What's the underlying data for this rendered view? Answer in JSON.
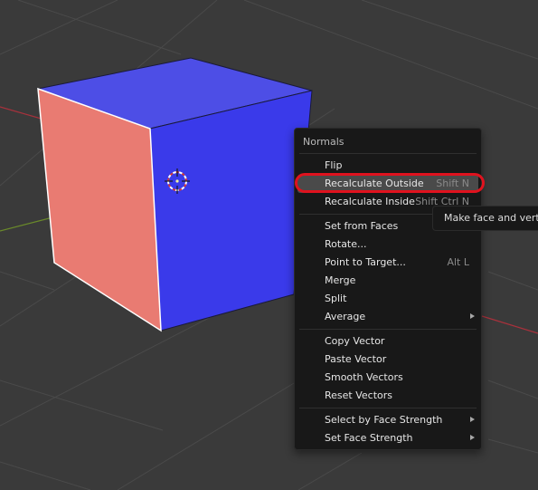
{
  "menu": {
    "title": "Normals",
    "items": [
      {
        "label": "Flip",
        "shortcut": "",
        "submenu": false,
        "highlighted": false
      },
      {
        "label": "Recalculate Outside",
        "shortcut": "Shift N",
        "submenu": false,
        "highlighted": true
      },
      {
        "label": "Recalculate Inside",
        "shortcut": "Shift Ctrl N",
        "submenu": false,
        "highlighted": false
      },
      {
        "label": "Set from Faces",
        "shortcut": "",
        "submenu": false,
        "highlighted": false
      },
      {
        "label": "Rotate...",
        "shortcut": "",
        "submenu": false,
        "highlighted": false
      },
      {
        "label": "Point to Target...",
        "shortcut": "Alt L",
        "submenu": false,
        "highlighted": false
      },
      {
        "label": "Merge",
        "shortcut": "",
        "submenu": false,
        "highlighted": false
      },
      {
        "label": "Split",
        "shortcut": "",
        "submenu": false,
        "highlighted": false
      },
      {
        "label": "Average",
        "shortcut": "",
        "submenu": true,
        "highlighted": false
      },
      {
        "label": "Copy Vector",
        "shortcut": "",
        "submenu": false,
        "highlighted": false
      },
      {
        "label": "Paste Vector",
        "shortcut": "",
        "submenu": false,
        "highlighted": false
      },
      {
        "label": "Smooth Vectors",
        "shortcut": "",
        "submenu": false,
        "highlighted": false
      },
      {
        "label": "Reset Vectors",
        "shortcut": "",
        "submenu": false,
        "highlighted": false
      },
      {
        "label": "Select by Face Strength",
        "shortcut": "",
        "submenu": true,
        "highlighted": false
      },
      {
        "label": "Set Face Strength",
        "shortcut": "",
        "submenu": true,
        "highlighted": false
      }
    ]
  },
  "tooltip": {
    "text": "Make face and verte"
  },
  "colors": {
    "viewport_bg": "#3a3a3a",
    "cube_top": "#4d4ee6",
    "cube_front": "#3a3aea",
    "cube_selected_face": "#e97b72",
    "x_axis": "#a8313c",
    "y_axis": "#6a8a2a",
    "highlight_ring": "#e0121e"
  }
}
